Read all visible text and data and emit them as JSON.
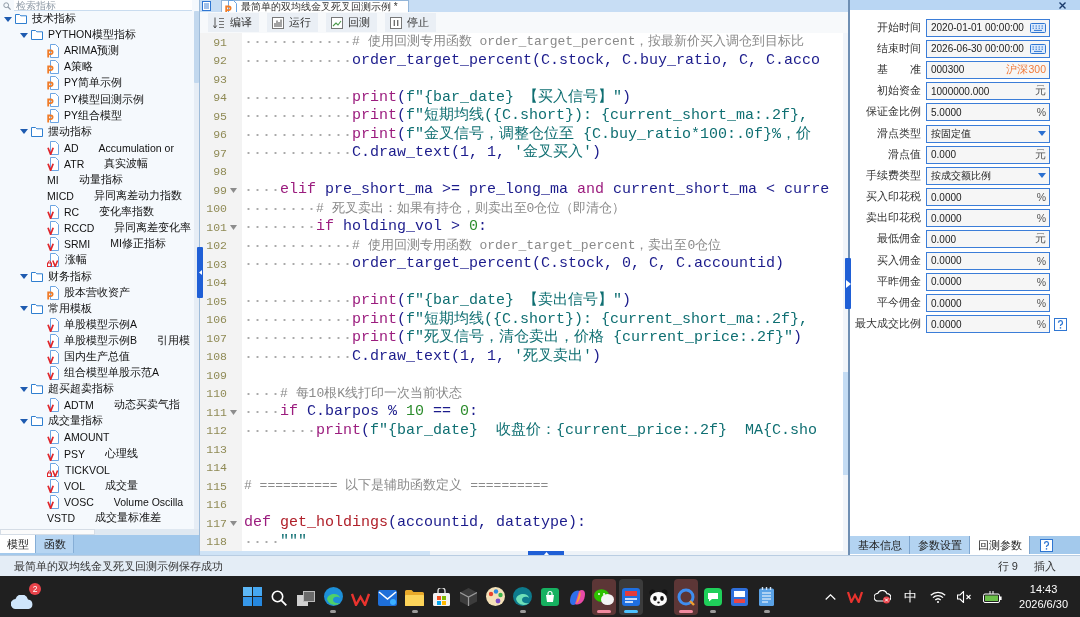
{
  "left_panel": {
    "search": {
      "placeholder": "检索指标"
    },
    "tree": [
      {
        "kind": "folder",
        "label": "技术指标",
        "expanded": true,
        "children": [
          {
            "kind": "folder",
            "label": "PYTHON模型指标",
            "expanded": true,
            "children": [
              {
                "kind": "python",
                "label": "ARIMA预测"
              },
              {
                "kind": "python",
                "label": "A策略"
              },
              {
                "kind": "python",
                "label": "PY简单示例"
              },
              {
                "kind": "python",
                "label": "PY模型回测示例"
              },
              {
                "kind": "python",
                "label": "PY组合模型"
              }
            ]
          },
          {
            "kind": "folder",
            "label": "摆动指标",
            "expanded": true,
            "children": [
              {
                "kind": "formula",
                "label": "AD",
                "description": "Accumulation or"
              },
              {
                "kind": "formula",
                "label": "ATR",
                "description": "真实波幅"
              },
              {
                "kind": "plain",
                "label": "MI",
                "description": "动量指标"
              },
              {
                "kind": "plain",
                "label": "MICD",
                "description": "异同离差动力指数"
              },
              {
                "kind": "formula",
                "label": "RC",
                "description": "变化率指数"
              },
              {
                "kind": "formula",
                "label": "RCCD",
                "description": "异同离差变化率"
              },
              {
                "kind": "formula",
                "label": "SRMI",
                "description": "MI修正指标"
              },
              {
                "kind": "encrypted",
                "label": "涨幅"
              }
            ]
          },
          {
            "kind": "folder",
            "label": "财务指标",
            "expanded": true,
            "children": [
              {
                "kind": "python",
                "label": "股本营收资产"
              }
            ]
          },
          {
            "kind": "folder",
            "label": "常用模板",
            "expanded": true,
            "children": [
              {
                "kind": "formula",
                "label": "单股模型示例A"
              },
              {
                "kind": "formula",
                "label": "单股模型示例B",
                "description": "引用模"
              },
              {
                "kind": "formula",
                "label": "国内生产总值"
              },
              {
                "kind": "formula",
                "label": "组合模型单股示范A"
              }
            ]
          },
          {
            "kind": "folder",
            "label": "超买超卖指标",
            "expanded": true,
            "children": [
              {
                "kind": "formula",
                "label": "ADTM",
                "description": "动态买卖气指"
              }
            ]
          },
          {
            "kind": "folder",
            "label": "成交量指标",
            "expanded": true,
            "children": [
              {
                "kind": "formula",
                "label": "AMOUNT"
              },
              {
                "kind": "formula",
                "label": "PSY",
                "description": "心理线"
              },
              {
                "kind": "encrypted",
                "label": "TICKVOL"
              },
              {
                "kind": "formula",
                "label": "VOL",
                "description": "成交量"
              },
              {
                "kind": "formula",
                "label": "VOSC",
                "description": "Volume Oscilla"
              },
              {
                "kind": "plain",
                "label": "VSTD",
                "description": "成交量标准差"
              }
            ]
          }
        ]
      }
    ],
    "tabs": [
      {
        "label": "模型",
        "selected": true
      },
      {
        "label": "函数",
        "selected": false
      }
    ]
  },
  "editor": {
    "file_tab": {
      "title": "最简单的双均线金叉死叉回测示例 *"
    },
    "toolbar": [
      {
        "kind": "compile",
        "label": "编译"
      },
      {
        "kind": "run",
        "label": "运行"
      },
      {
        "kind": "backtest",
        "label": "回测"
      },
      {
        "kind": "stop",
        "label": "停止"
      }
    ],
    "lines": [
      {
        "number": "91",
        "foldable": false,
        "tokens": [
          {
            "kind": "comment",
            "text": "            # 使用回测专用函数 order_target_percent，按最新价买入调仓到目标比"
          }
        ]
      },
      {
        "number": "92",
        "foldable": false,
        "tokens": [
          {
            "kind": "name",
            "text": "            order_target_percent(C.stock, C.buy_ratio, C, C.acco"
          }
        ]
      },
      {
        "number": "93",
        "foldable": false
      },
      {
        "number": "94",
        "foldable": false,
        "tokens": [
          {
            "kind": "keyword",
            "text": "            print"
          },
          {
            "kind": "name",
            "text": "("
          },
          {
            "kind": "string",
            "text": "f\"{bar_date} 【买入信号】\""
          },
          {
            "kind": "name",
            "text": ")"
          }
        ]
      },
      {
        "number": "95",
        "foldable": false,
        "tokens": [
          {
            "kind": "keyword",
            "text": "            print"
          },
          {
            "kind": "name",
            "text": "("
          },
          {
            "kind": "string",
            "text": "f\"短期均线({C.short}): {current_short_ma:.2f},"
          }
        ]
      },
      {
        "number": "96",
        "foldable": false,
        "tokens": [
          {
            "kind": "keyword",
            "text": "            print"
          },
          {
            "kind": "name",
            "text": "("
          },
          {
            "kind": "string",
            "text": "f\"金叉信号，调整仓位至 {C.buy_ratio*100:.0f}%，价"
          }
        ]
      },
      {
        "number": "97",
        "foldable": false,
        "tokens": [
          {
            "kind": "name",
            "text": "            C.draw_text(1, 1, "
          },
          {
            "kind": "string",
            "text": "'金叉买入'"
          },
          {
            "kind": "name",
            "text": ")"
          }
        ]
      },
      {
        "number": "98",
        "foldable": false
      },
      {
        "number": "99",
        "foldable": true,
        "tokens": [
          {
            "kind": "keyword",
            "text": "    elif"
          },
          {
            "kind": "name",
            "text": " pre_short_ma >= pre_long_ma "
          },
          {
            "kind": "keyword",
            "text": "and"
          },
          {
            "kind": "name",
            "text": " current_short_ma < curre"
          }
        ]
      },
      {
        "number": "100",
        "foldable": false,
        "tokens": [
          {
            "kind": "comment",
            "text": "        # 死叉卖出：如果有持仓，则卖出至0仓位（即清仓）"
          }
        ]
      },
      {
        "number": "101",
        "foldable": true,
        "tokens": [
          {
            "kind": "keyword",
            "text": "        if"
          },
          {
            "kind": "name",
            "text": " holding_vol > "
          },
          {
            "kind": "number",
            "text": "0"
          },
          {
            "kind": "name",
            "text": ":"
          }
        ]
      },
      {
        "number": "102",
        "foldable": false,
        "tokens": [
          {
            "kind": "comment",
            "text": "            # 使用回测专用函数 order_target_percent，卖出至0仓位"
          }
        ]
      },
      {
        "number": "103",
        "foldable": false,
        "tokens": [
          {
            "kind": "name",
            "text": "            order_target_percent(C.stock, 0, C, C.accountid)"
          }
        ]
      },
      {
        "number": "104",
        "foldable": false
      },
      {
        "number": "105",
        "foldable": false,
        "tokens": [
          {
            "kind": "keyword",
            "text": "            print"
          },
          {
            "kind": "name",
            "text": "("
          },
          {
            "kind": "string",
            "text": "f\"{bar_date} 【卖出信号】\""
          },
          {
            "kind": "name",
            "text": ")"
          }
        ]
      },
      {
        "number": "106",
        "foldable": false,
        "tokens": [
          {
            "kind": "keyword",
            "text": "            print"
          },
          {
            "kind": "name",
            "text": "("
          },
          {
            "kind": "string",
            "text": "f\"短期均线({C.short}): {current_short_ma:.2f},"
          }
        ]
      },
      {
        "number": "107",
        "foldable": false,
        "tokens": [
          {
            "kind": "keyword",
            "text": "            print"
          },
          {
            "kind": "name",
            "text": "("
          },
          {
            "kind": "string",
            "text": "f\"死叉信号，清仓卖出，价格 {current_price:.2f}\""
          },
          {
            "kind": "name",
            "text": ")"
          }
        ]
      },
      {
        "number": "108",
        "foldable": false,
        "tokens": [
          {
            "kind": "name",
            "text": "            C.draw_text(1, 1, "
          },
          {
            "kind": "string",
            "text": "'死叉卖出'"
          },
          {
            "kind": "name",
            "text": ")"
          }
        ]
      },
      {
        "number": "109",
        "foldable": false
      },
      {
        "number": "110",
        "foldable": false,
        "tokens": [
          {
            "kind": "comment",
            "text": "    # 每10根K线打印一次当前状态"
          }
        ]
      },
      {
        "number": "111",
        "foldable": true,
        "tokens": [
          {
            "kind": "keyword",
            "text": "    if"
          },
          {
            "kind": "name",
            "text": " C.barpos % "
          },
          {
            "kind": "number",
            "text": "10"
          },
          {
            "kind": "name",
            "text": " == "
          },
          {
            "kind": "number",
            "text": "0"
          },
          {
            "kind": "name",
            "text": ":"
          }
        ]
      },
      {
        "number": "112",
        "foldable": false,
        "tokens": [
          {
            "kind": "keyword",
            "text": "        print"
          },
          {
            "kind": "name",
            "text": "("
          },
          {
            "kind": "string",
            "text": "f\"{bar_date}  收盘价：{current_price:.2f}  MA{C.sho"
          }
        ]
      },
      {
        "number": "113",
        "foldable": false
      },
      {
        "number": "114",
        "foldable": false
      },
      {
        "number": "115",
        "foldable": false,
        "tokens": [
          {
            "kind": "comment",
            "text": "# ========== 以下是辅助函数定义 =========="
          }
        ]
      },
      {
        "number": "116",
        "foldable": false
      },
      {
        "number": "117",
        "foldable": true,
        "tokens": [
          {
            "kind": "keyword",
            "text": "def"
          },
          {
            "kind": "defname",
            "text": " get_holdings"
          },
          {
            "kind": "name",
            "text": "(accountid, datatype):"
          }
        ]
      },
      {
        "number": "118",
        "foldable": false,
        "tokens": [
          {
            "kind": "string",
            "text": "    \"\"\""
          }
        ]
      }
    ]
  },
  "backtest_params": {
    "fields": [
      {
        "label": "开始时间",
        "kind": "datetime",
        "value": "2020-01-01 00:00:00",
        "help": false
      },
      {
        "label": "结束时间",
        "kind": "datetime",
        "value": "2026-06-30 00:00:00",
        "help": false
      },
      {
        "label": "基　　准",
        "kind": "benchmark",
        "value": "000300",
        "suffix": "沪深300",
        "help": false
      },
      {
        "label": "初始资金",
        "kind": "number",
        "value": "1000000.000",
        "unit": "元",
        "help": false
      },
      {
        "label": "保证金比例",
        "kind": "number",
        "value": "5.0000",
        "unit": "%",
        "help": false
      },
      {
        "label": "滑点类型",
        "kind": "select",
        "value": "按固定值",
        "help": false
      },
      {
        "label": "滑点值",
        "kind": "number",
        "value": "0.000",
        "unit": "元",
        "help": false
      },
      {
        "label": "手续费类型",
        "kind": "select",
        "value": "按成交额比例",
        "help": false
      },
      {
        "label": "买入印花税",
        "kind": "number",
        "value": "0.0000",
        "unit": "%",
        "help": false
      },
      {
        "label": "卖出印花税",
        "kind": "number",
        "value": "0.0000",
        "unit": "%",
        "help": false
      },
      {
        "label": "最低佣金",
        "kind": "number",
        "value": "0.000",
        "unit": "元",
        "help": false
      },
      {
        "label": "买入佣金",
        "kind": "number",
        "value": "0.0000",
        "unit": "%",
        "help": false
      },
      {
        "label": "平昨佣金",
        "kind": "number",
        "value": "0.0000",
        "unit": "%",
        "help": false
      },
      {
        "label": "平今佣金",
        "kind": "number",
        "value": "0.0000",
        "unit": "%",
        "help": false
      },
      {
        "label": "最大成交比例",
        "kind": "number",
        "value": "0.0000",
        "unit": "%",
        "help": true
      }
    ],
    "tabs": [
      {
        "label": "基本信息",
        "selected": false
      },
      {
        "label": "参数设置",
        "selected": false
      },
      {
        "label": "回测参数",
        "selected": true
      }
    ]
  },
  "status_bar": {
    "message": "最简单的双均线金叉死叉回测示例保存成功",
    "position": "行 9",
    "mode": "插入"
  },
  "taskbar": {
    "weather_badge": "2",
    "apps": [
      {
        "kind": "start",
        "running": false,
        "active": false,
        "attention": false
      },
      {
        "kind": "search",
        "running": false,
        "active": false,
        "attention": false
      },
      {
        "kind": "taskview",
        "running": false,
        "active": false,
        "attention": false
      },
      {
        "kind": "swirl",
        "running": true,
        "active": false,
        "attention": false
      },
      {
        "kind": "zigzag",
        "running": false,
        "active": false,
        "attention": false
      },
      {
        "kind": "mail",
        "running": false,
        "active": false,
        "attention": false
      },
      {
        "kind": "folder",
        "running": true,
        "active": false,
        "attention": false
      },
      {
        "kind": "store",
        "running": false,
        "active": false,
        "attention": false
      },
      {
        "kind": "cube",
        "running": false,
        "active": false,
        "attention": false
      },
      {
        "kind": "palette",
        "running": false,
        "active": false,
        "attention": false
      },
      {
        "kind": "swirl2",
        "running": true,
        "active": false,
        "attention": false
      },
      {
        "kind": "bag",
        "running": false,
        "active": false,
        "attention": false
      },
      {
        "kind": "ribbon",
        "running": false,
        "active": false,
        "attention": false
      },
      {
        "kind": "bubbles",
        "running": true,
        "active": true,
        "attention": true
      },
      {
        "kind": "news",
        "running": true,
        "active": true,
        "attention": false
      },
      {
        "kind": "panda",
        "running": false,
        "active": false,
        "attention": false
      },
      {
        "kind": "ring",
        "running": true,
        "active": true,
        "attention": true
      },
      {
        "kind": "chat",
        "running": true,
        "active": false,
        "attention": false
      },
      {
        "kind": "book",
        "running": false,
        "active": false,
        "attention": false
      },
      {
        "kind": "notepad",
        "running": true,
        "active": false,
        "attention": false
      }
    ],
    "ime": "中",
    "clock": {
      "time": "14:43",
      "date": "2026/6/30"
    }
  }
}
